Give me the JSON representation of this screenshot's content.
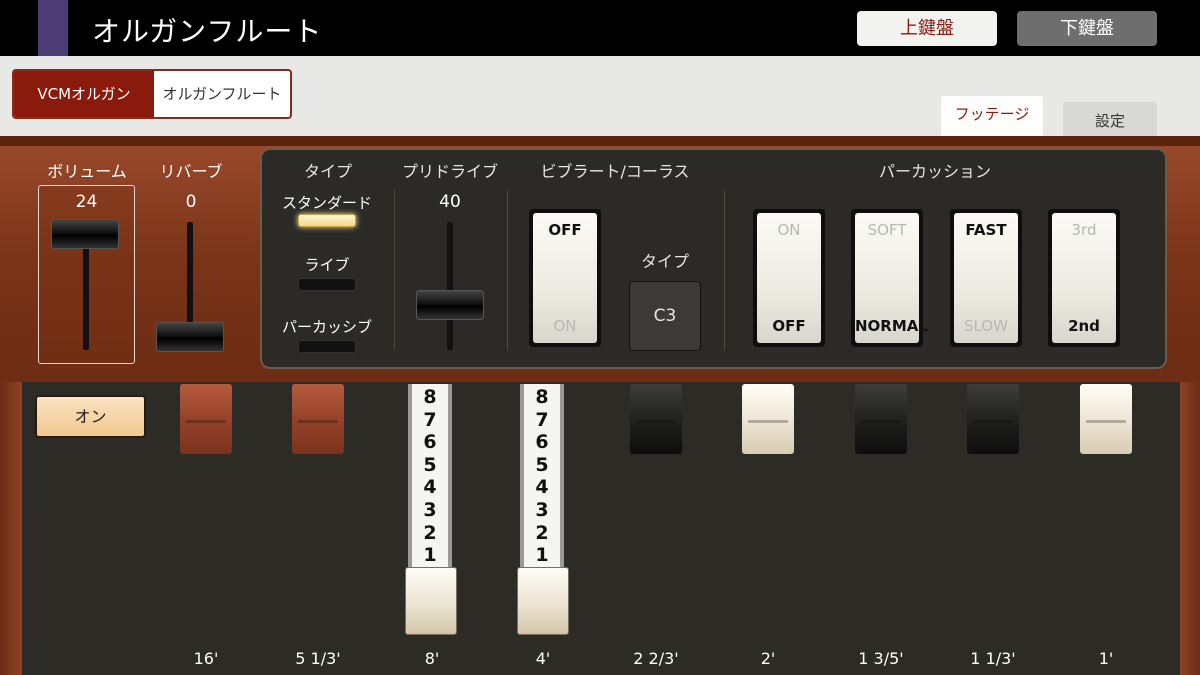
{
  "header": {
    "title": "オルガンフルート",
    "keyboard_upper": "上鍵盤",
    "keyboard_lower": "下鍵盤"
  },
  "voice_tabs": {
    "vcm": "VCMオルガン",
    "organ_flute": "オルガンフルート",
    "selected": "organ_flute"
  },
  "page_tabs": {
    "footage": "フッテージ",
    "settings": "設定",
    "selected": "footage"
  },
  "volume": {
    "label": "ボリューム",
    "value": "24"
  },
  "reverb": {
    "label": "リバーブ",
    "value": "0"
  },
  "type": {
    "label": "タイプ",
    "options": [
      "スタンダード",
      "ライブ",
      "パーカッシブ"
    ],
    "selected": "スタンダード"
  },
  "overdrive": {
    "label": "プリドライブ",
    "value": "40"
  },
  "vibrato_chorus": {
    "label": "ビブラート/コーラス",
    "switch_top": "OFF",
    "switch_bottom": "ON",
    "state": "OFF",
    "type_label": "タイプ",
    "type_value": "C3"
  },
  "percussion": {
    "label": "パーカッション",
    "switches": [
      {
        "top": "ON",
        "bottom": "OFF",
        "state": "OFF"
      },
      {
        "top": "SOFT",
        "bottom": "NORMAL",
        "state": "NORMAL"
      },
      {
        "top": "FAST",
        "bottom": "SLOW",
        "state": "FAST"
      },
      {
        "top": "3rd",
        "bottom": "2nd",
        "state": "2nd"
      }
    ]
  },
  "drawbar_area": {
    "on_button": "オン",
    "scale_numbers": [
      "8",
      "7",
      "6",
      "5",
      "4",
      "3",
      "2",
      "1"
    ],
    "footages": [
      "16'",
      "5 1/3'",
      "8'",
      "4'",
      "2 2/3'",
      "2'",
      "1 3/5'",
      "1 1/3'",
      "1'"
    ],
    "drawbar_levels": [
      0,
      0,
      8,
      8,
      0,
      0,
      0,
      0,
      0
    ]
  },
  "colors": {
    "accent": "#8a1a0c",
    "wood": "#7a3418",
    "panel": "#2b2a27",
    "lamp_on": "#f2d98a"
  }
}
